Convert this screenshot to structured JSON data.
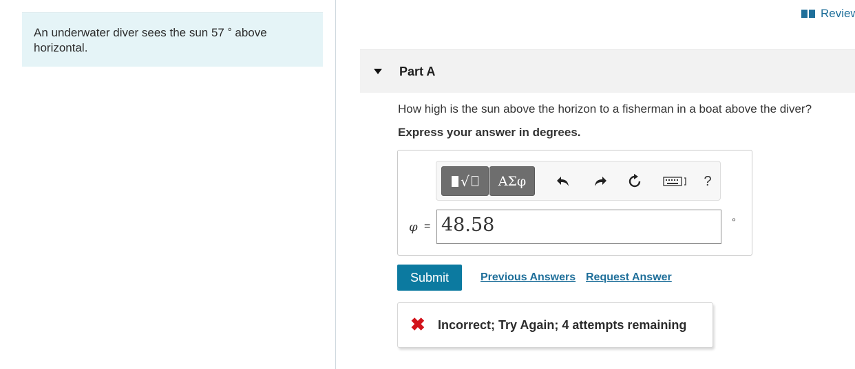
{
  "header": {
    "review_label": "Review"
  },
  "problem": {
    "text_before": "An underwater diver sees the sun 57",
    "degree_symbol": "°",
    "text_after": "above horizontal."
  },
  "part": {
    "title": "Part A"
  },
  "question": {
    "prompt": "How high is the sun above the horizon to a fisherman in a boat above the diver?",
    "instruction": "Express your answer in degrees."
  },
  "toolbar": {
    "symbols_label": "ΑΣφ",
    "help_label": "?",
    "icons": [
      "templates-icon",
      "greek-symbols-icon",
      "undo-icon",
      "redo-icon",
      "reset-icon",
      "keyboard-icon",
      "help-icon"
    ]
  },
  "answer": {
    "variable": "φ",
    "equals": "=",
    "value": "48.58",
    "unit": "°"
  },
  "actions": {
    "submit_label": "Submit",
    "previous_answers_label": "Previous Answers",
    "request_answer_label": "Request Answer"
  },
  "feedback": {
    "icon": "incorrect-x-icon",
    "message": "Incorrect; Try Again; 4 attempts remaining"
  },
  "colors": {
    "accent": "#0c7aa0",
    "link": "#1f6f9a",
    "error": "#d2131b",
    "problem_bg": "#e5f4f7"
  }
}
